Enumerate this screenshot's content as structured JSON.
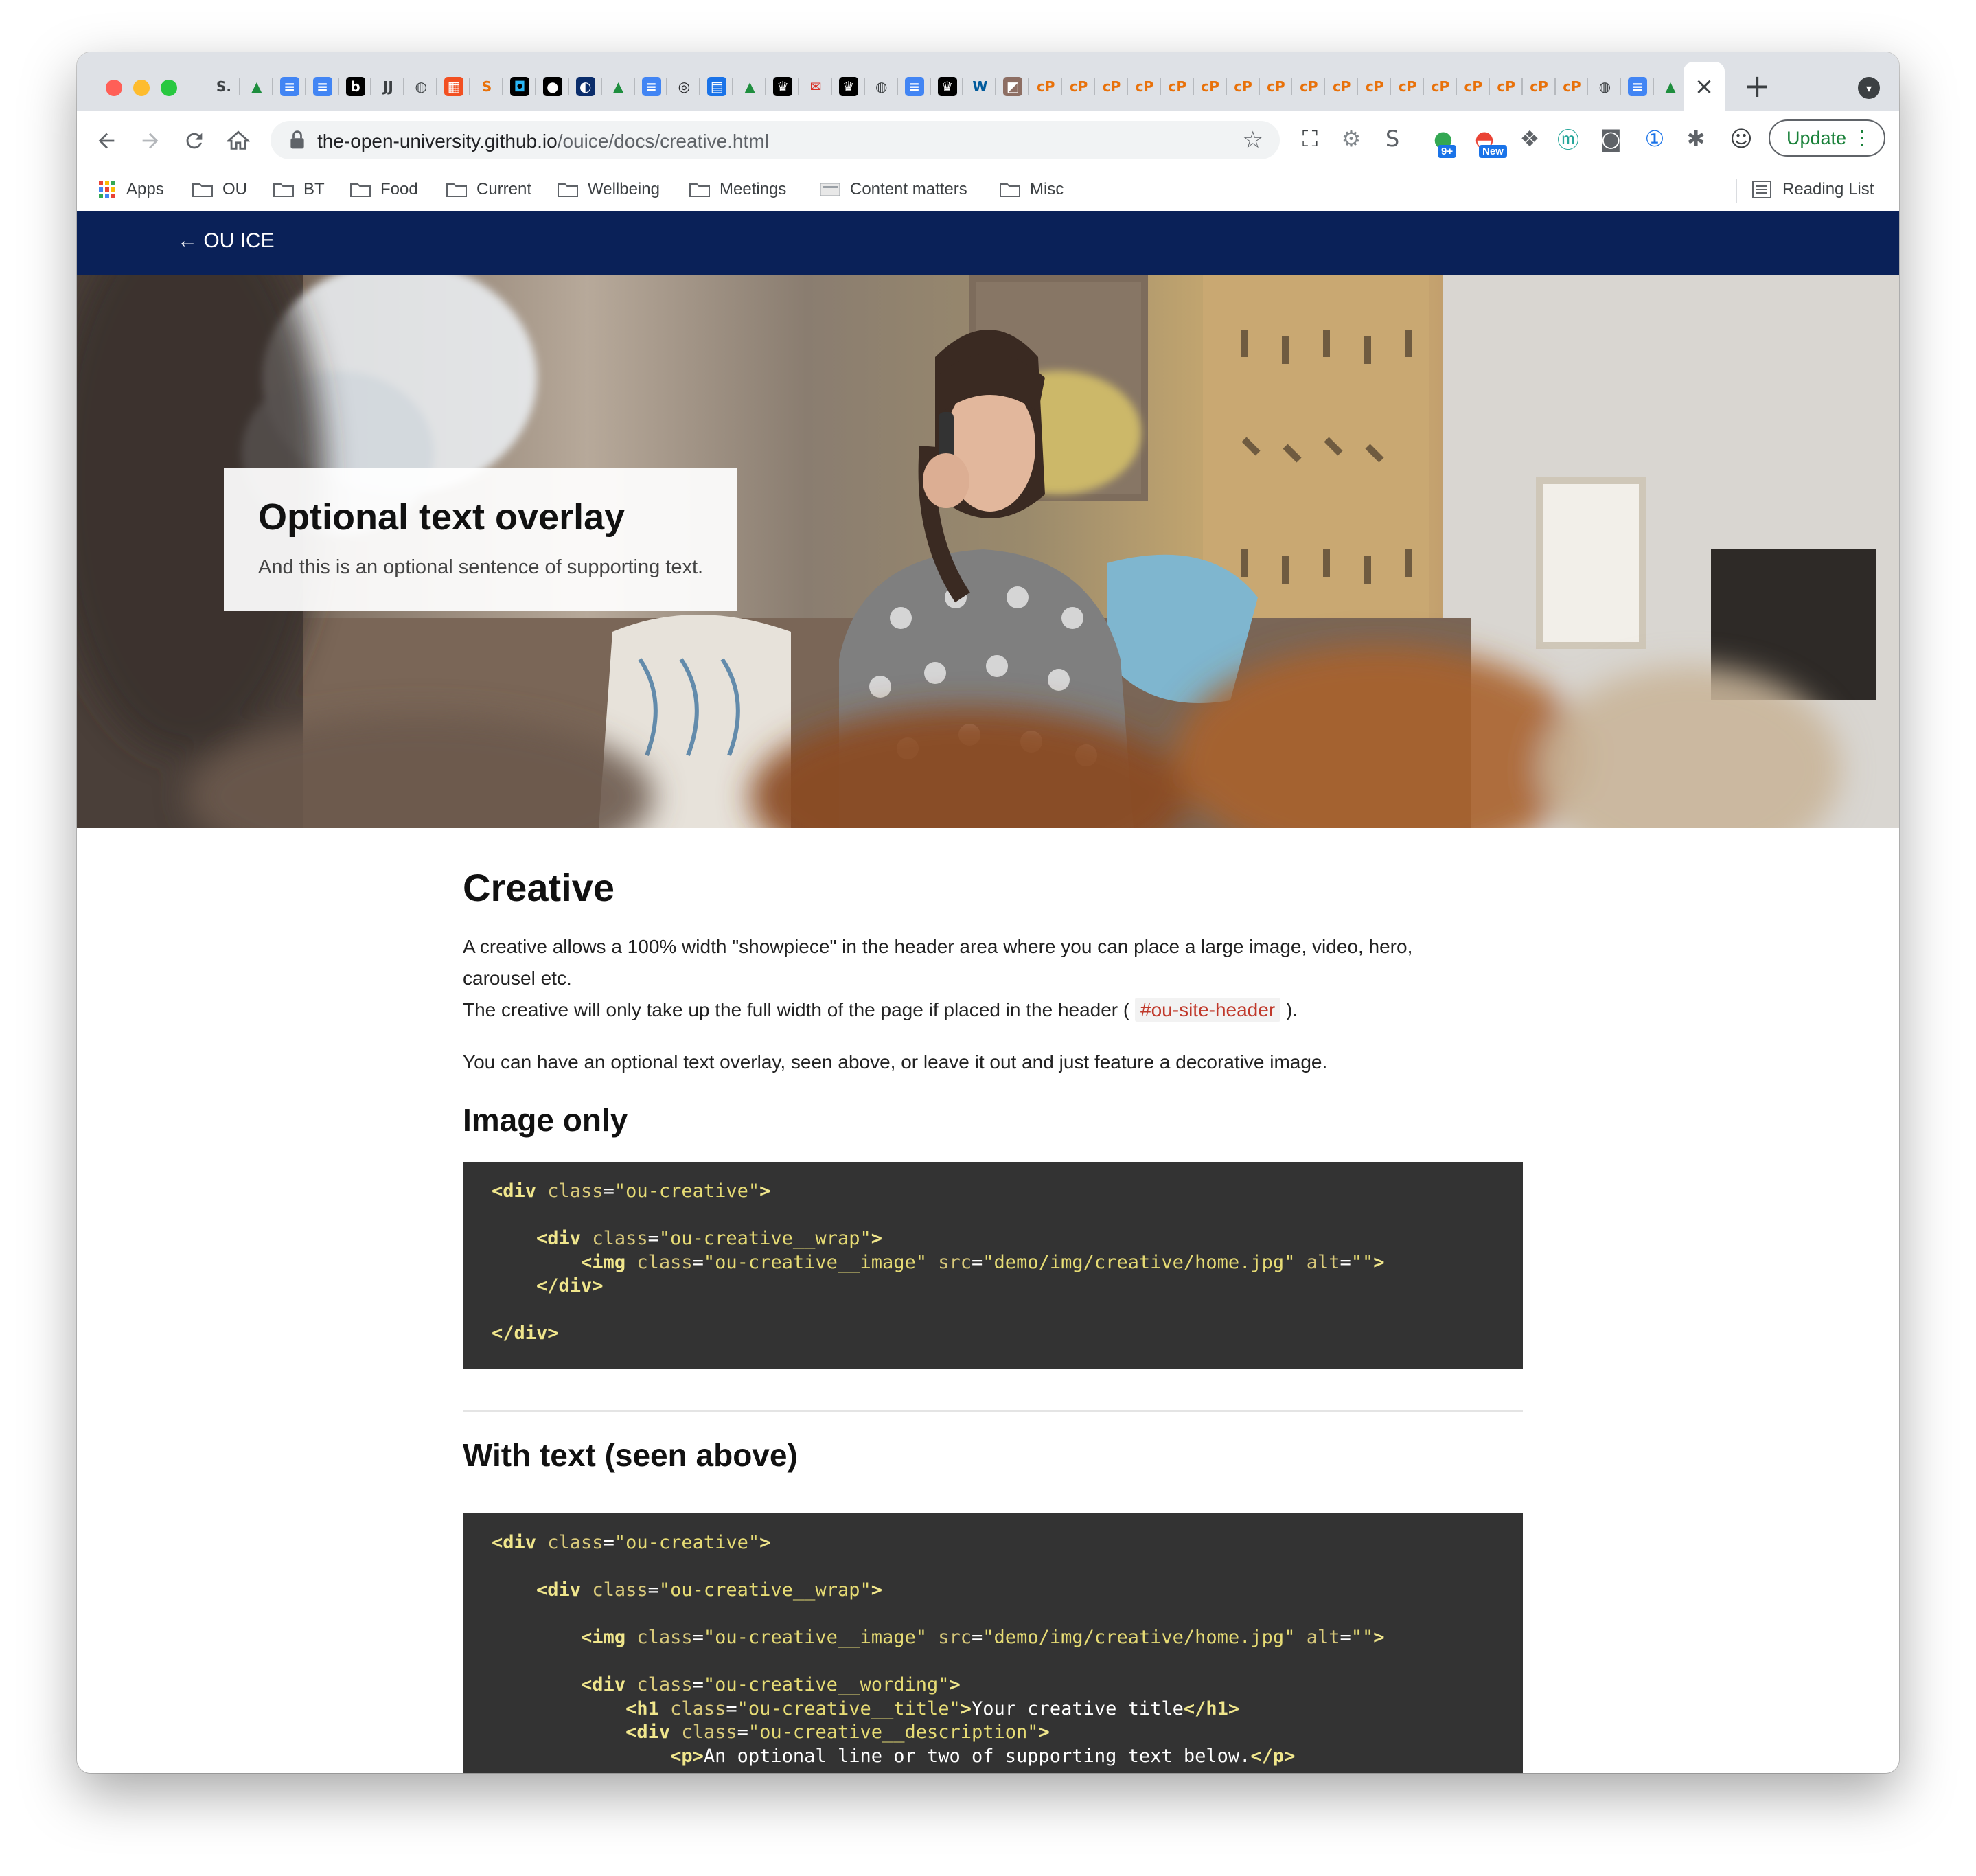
{
  "browser": {
    "url_host": "the-open-university.github.io",
    "url_path": "/ouice/docs/creative.html",
    "tab_icons": [
      {
        "glyph": "S.",
        "bg": "#dee1e6",
        "fg": "#3c4043"
      },
      {
        "glyph": "▲",
        "bg": "#dee1e6",
        "fg": "#1e8e3e"
      },
      {
        "glyph": "≡",
        "bg": "#4285f4",
        "fg": "#ffffff"
      },
      {
        "glyph": "≡",
        "bg": "#4285f4",
        "fg": "#ffffff"
      },
      {
        "glyph": "b",
        "bg": "#000000",
        "fg": "#ffffff"
      },
      {
        "glyph": "JJ",
        "bg": "#dee1e6",
        "fg": "#3c4043"
      },
      {
        "glyph": "◍",
        "bg": "#dee1e6",
        "fg": "#3c4043"
      },
      {
        "glyph": "▦",
        "bg": "#f25022",
        "fg": "#ffffff"
      },
      {
        "glyph": "S",
        "bg": "#dee1e6",
        "fg": "#e8710a"
      },
      {
        "glyph": "◘",
        "bg": "#000000",
        "fg": "#29b6f6"
      },
      {
        "glyph": "●",
        "bg": "#000000",
        "fg": "#ffffff"
      },
      {
        "glyph": "◐",
        "bg": "#0b2d6b",
        "fg": "#ffffff"
      },
      {
        "glyph": "▲",
        "bg": "#dee1e6",
        "fg": "#1e8e3e"
      },
      {
        "glyph": "≡",
        "bg": "#4285f4",
        "fg": "#ffffff"
      },
      {
        "glyph": "◎",
        "bg": "#dee1e6",
        "fg": "#202124"
      },
      {
        "glyph": "▤",
        "bg": "#1a73e8",
        "fg": "#ffffff"
      },
      {
        "glyph": "▲",
        "bg": "#dee1e6",
        "fg": "#1e8e3e"
      },
      {
        "glyph": "♛",
        "bg": "#000000",
        "fg": "#ffffff"
      },
      {
        "glyph": "✉",
        "bg": "#dee1e6",
        "fg": "#d93025"
      },
      {
        "glyph": "♛",
        "bg": "#000000",
        "fg": "#ffffff"
      },
      {
        "glyph": "◍",
        "bg": "#dee1e6",
        "fg": "#3c4043"
      },
      {
        "glyph": "≡",
        "bg": "#4285f4",
        "fg": "#ffffff"
      },
      {
        "glyph": "♛",
        "bg": "#000000",
        "fg": "#ffffff"
      },
      {
        "glyph": "W",
        "bg": "#dee1e6",
        "fg": "#005a9c"
      },
      {
        "glyph": "◩",
        "bg": "#8d6e63",
        "fg": "#ffffff"
      },
      {
        "glyph": "cP",
        "bg": "#dee1e6",
        "fg": "#e8710a"
      },
      {
        "glyph": "cP",
        "bg": "#dee1e6",
        "fg": "#e8710a"
      },
      {
        "glyph": "cP",
        "bg": "#dee1e6",
        "fg": "#e8710a"
      },
      {
        "glyph": "cP",
        "bg": "#dee1e6",
        "fg": "#e8710a"
      },
      {
        "glyph": "cP",
        "bg": "#dee1e6",
        "fg": "#e8710a"
      },
      {
        "glyph": "cP",
        "bg": "#dee1e6",
        "fg": "#e8710a"
      },
      {
        "glyph": "cP",
        "bg": "#dee1e6",
        "fg": "#e8710a"
      },
      {
        "glyph": "cP",
        "bg": "#dee1e6",
        "fg": "#e8710a"
      },
      {
        "glyph": "cP",
        "bg": "#dee1e6",
        "fg": "#e8710a"
      },
      {
        "glyph": "cP",
        "bg": "#dee1e6",
        "fg": "#e8710a"
      },
      {
        "glyph": "cP",
        "bg": "#dee1e6",
        "fg": "#e8710a"
      },
      {
        "glyph": "cP",
        "bg": "#dee1e6",
        "fg": "#e8710a"
      },
      {
        "glyph": "cP",
        "bg": "#dee1e6",
        "fg": "#e8710a"
      },
      {
        "glyph": "cP",
        "bg": "#dee1e6",
        "fg": "#e8710a"
      },
      {
        "glyph": "cP",
        "bg": "#dee1e6",
        "fg": "#e8710a"
      },
      {
        "glyph": "cP",
        "bg": "#dee1e6",
        "fg": "#e8710a"
      },
      {
        "glyph": "cP",
        "bg": "#dee1e6",
        "fg": "#e8710a"
      },
      {
        "glyph": "◍",
        "bg": "#dee1e6",
        "fg": "#3c4043"
      },
      {
        "glyph": "≡",
        "bg": "#4285f4",
        "fg": "#ffffff"
      },
      {
        "glyph": "▲",
        "bg": "#dee1e6",
        "fg": "#1e8e3e"
      },
      {
        "glyph": "▭",
        "bg": "#f9ab00",
        "fg": "#ffffff"
      }
    ],
    "toolbar_extensions": [
      {
        "name": "screenshot-icon",
        "glyph": "⛶",
        "color": "#3c4043"
      },
      {
        "name": "settings-gear-icon",
        "glyph": "⚙",
        "color": "#80868b"
      },
      {
        "name": "s-extension-icon",
        "glyph": "S",
        "color": "#5f6368"
      },
      {
        "name": "chat-extension-icon",
        "glyph": "●",
        "color": "#34a853",
        "badge": "9+"
      },
      {
        "name": "new-extension-icon",
        "glyph": "◓",
        "color": "#ea4335",
        "badge": "New"
      },
      {
        "name": "dropbox-icon",
        "glyph": "❖",
        "color": "#5f6368"
      },
      {
        "name": "m-extension-icon",
        "glyph": "ⓜ",
        "color": "#26a69a"
      },
      {
        "name": "reader-extension-icon",
        "glyph": "◙",
        "color": "#5f6368"
      },
      {
        "name": "password-extension-icon",
        "glyph": "①",
        "color": "#1a73e8"
      },
      {
        "name": "extensions-puzzle-icon",
        "glyph": "✱",
        "color": "#5f6368"
      },
      {
        "name": "profile-avatar-icon",
        "glyph": "☺",
        "color": "#3c4043"
      }
    ],
    "update_label": "Update",
    "bookmarks": [
      "Apps",
      "OU",
      "BT",
      "Food",
      "Current",
      "Wellbeing",
      "Meetings",
      "Content matters",
      "Misc"
    ],
    "reading_list": "Reading List"
  },
  "site_nav": {
    "back_label": "← OU ICE"
  },
  "hero": {
    "overlay_title": "Optional text overlay",
    "overlay_sub": "And this is an optional sentence of supporting text."
  },
  "content": {
    "title": "Creative",
    "p1": "A creative allows a 100% width \"showpiece\" in the header area where you can place a large image, video, hero, carousel etc.",
    "p2_before": "The creative will only take up the full width of the page if placed in the header (",
    "p2_code": "#ou-site-header",
    "p2_after": ").",
    "p3": "You can have an optional text overlay, seen above, or leave it out and just feature a decorative image.",
    "h_image_only": "Image only",
    "h_with_text": "With text (seen above)",
    "code1": [
      [
        [
          "t",
          "<div "
        ],
        [
          "a",
          "class"
        ],
        [
          "tx",
          "="
        ],
        [
          "s",
          "\"ou-creative\""
        ],
        [
          "t",
          ">"
        ]
      ],
      [],
      [
        [
          "tx",
          "    "
        ],
        [
          "t",
          "<div "
        ],
        [
          "a",
          "class"
        ],
        [
          "tx",
          "="
        ],
        [
          "s",
          "\"ou-creative__wrap\""
        ],
        [
          "t",
          ">"
        ]
      ],
      [
        [
          "tx",
          "        "
        ],
        [
          "t",
          "<img "
        ],
        [
          "a",
          "class"
        ],
        [
          "tx",
          "="
        ],
        [
          "s",
          "\"ou-creative__image\""
        ],
        [
          "tx",
          " "
        ],
        [
          "a",
          "src"
        ],
        [
          "tx",
          "="
        ],
        [
          "s",
          "\"demo/img/creative/home.jpg\""
        ],
        [
          "tx",
          " "
        ],
        [
          "a",
          "alt"
        ],
        [
          "tx",
          "="
        ],
        [
          "s",
          "\"\""
        ],
        [
          "t",
          ">"
        ]
      ],
      [
        [
          "tx",
          "    "
        ],
        [
          "t",
          "</div>"
        ]
      ],
      [],
      [
        [
          "t",
          "</div>"
        ]
      ]
    ],
    "code2": [
      [
        [
          "t",
          "<div "
        ],
        [
          "a",
          "class"
        ],
        [
          "tx",
          "="
        ],
        [
          "s",
          "\"ou-creative\""
        ],
        [
          "t",
          ">"
        ]
      ],
      [],
      [
        [
          "tx",
          "    "
        ],
        [
          "t",
          "<div "
        ],
        [
          "a",
          "class"
        ],
        [
          "tx",
          "="
        ],
        [
          "s",
          "\"ou-creative__wrap\""
        ],
        [
          "t",
          ">"
        ]
      ],
      [],
      [
        [
          "tx",
          "        "
        ],
        [
          "t",
          "<img "
        ],
        [
          "a",
          "class"
        ],
        [
          "tx",
          "="
        ],
        [
          "s",
          "\"ou-creative__image\""
        ],
        [
          "tx",
          " "
        ],
        [
          "a",
          "src"
        ],
        [
          "tx",
          "="
        ],
        [
          "s",
          "\"demo/img/creative/home.jpg\""
        ],
        [
          "tx",
          " "
        ],
        [
          "a",
          "alt"
        ],
        [
          "tx",
          "="
        ],
        [
          "s",
          "\"\""
        ],
        [
          "t",
          ">"
        ]
      ],
      [],
      [
        [
          "tx",
          "        "
        ],
        [
          "t",
          "<div "
        ],
        [
          "a",
          "class"
        ],
        [
          "tx",
          "="
        ],
        [
          "s",
          "\"ou-creative__wording\""
        ],
        [
          "t",
          ">"
        ]
      ],
      [
        [
          "tx",
          "            "
        ],
        [
          "t",
          "<h1 "
        ],
        [
          "a",
          "class"
        ],
        [
          "tx",
          "="
        ],
        [
          "s",
          "\"ou-creative__title\""
        ],
        [
          "t",
          ">"
        ],
        [
          "tx",
          "Your creative title"
        ],
        [
          "t",
          "</h1>"
        ]
      ],
      [
        [
          "tx",
          "            "
        ],
        [
          "t",
          "<div "
        ],
        [
          "a",
          "class"
        ],
        [
          "tx",
          "="
        ],
        [
          "s",
          "\"ou-creative__description\""
        ],
        [
          "t",
          ">"
        ]
      ],
      [
        [
          "tx",
          "                "
        ],
        [
          "t",
          "<p>"
        ],
        [
          "tx",
          "An optional line or two of supporting text below."
        ],
        [
          "t",
          "</p>"
        ]
      ]
    ]
  }
}
